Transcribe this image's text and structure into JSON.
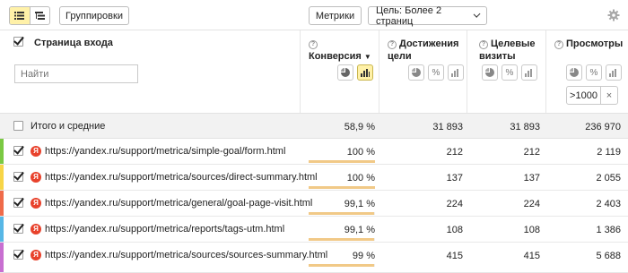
{
  "toolbar": {
    "view_modes": [
      "list-view-icon",
      "tree-view-icon"
    ],
    "grouping_label": "Группировки",
    "metrics_label": "Метрики",
    "goal_select": "Цель: Более 2 страниц"
  },
  "header": {
    "dimension_title": "Страница входа",
    "search_placeholder": "Найти",
    "columns": [
      {
        "key": "conversion",
        "title": "Конверсия",
        "sorted": "desc"
      },
      {
        "key": "goal_reaches",
        "title": "Достижения цели"
      },
      {
        "key": "target_visits",
        "title": "Целевые визиты"
      },
      {
        "key": "pageviews",
        "title": "Просмотры"
      }
    ],
    "filter": {
      "value": ">1000",
      "clear": "×"
    }
  },
  "totals": {
    "label": "Итого и средние",
    "values": [
      "58,9 %",
      "31 893",
      "31 893",
      "236 970"
    ]
  },
  "rows": [
    {
      "url": "https://yandex.ru/support/metrica/simple-goal/form.html",
      "checked": true,
      "color": "#7ac943",
      "values": [
        "100 %",
        "212",
        "212",
        "2 119"
      ],
      "conversion": 1.0
    },
    {
      "url": "https://yandex.ru/support/metrica/sources/direct-summary.html",
      "checked": true,
      "color": "#f7d547",
      "values": [
        "100 %",
        "137",
        "137",
        "2 055"
      ],
      "conversion": 1.0
    },
    {
      "url": "https://yandex.ru/support/metrica/general/goal-page-visit.html",
      "checked": true,
      "color": "#ef6b4a",
      "values": [
        "99,1 %",
        "224",
        "224",
        "2 403"
      ],
      "conversion": 0.991
    },
    {
      "url": "https://yandex.ru/support/metrica/reports/tags-utm.html",
      "checked": true,
      "color": "#57b7e6",
      "values": [
        "99,1 %",
        "108",
        "108",
        "1 386"
      ],
      "conversion": 0.991
    },
    {
      "url": "https://yandex.ru/support/metrica/sources/sources-summary.html",
      "checked": true,
      "color": "#c86fd1",
      "values": [
        "99 %",
        "415",
        "415",
        "5 688"
      ],
      "conversion": 0.99
    }
  ],
  "colors": {
    "accent_yellow": "#fff1a8",
    "bar": "#f1c987",
    "logo_red": "#e8422c"
  }
}
